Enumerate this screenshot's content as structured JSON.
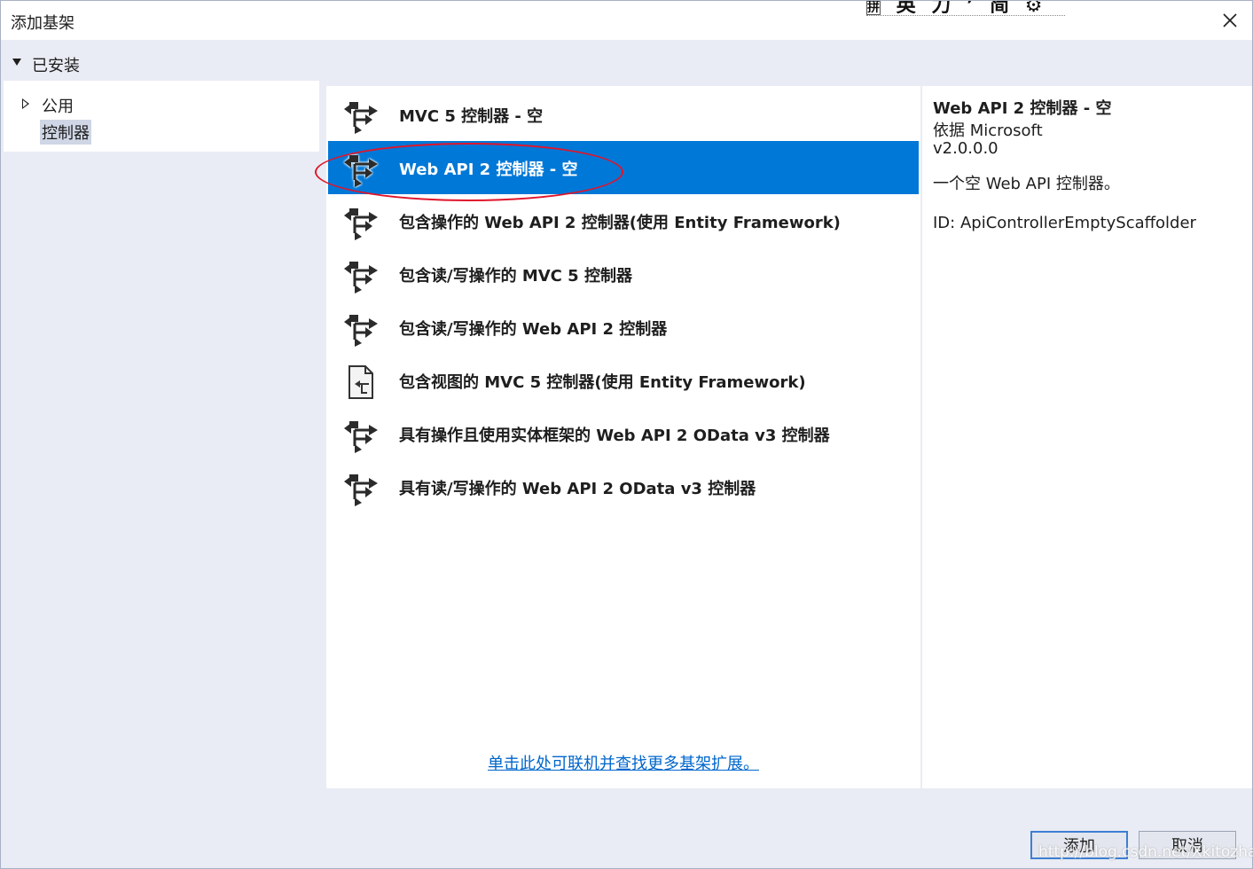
{
  "window": {
    "title": "添加基架"
  },
  "ime_bar": {
    "items": [
      "拼",
      "英",
      "力",
      "’",
      "简",
      "⚙"
    ]
  },
  "tree": {
    "installed_label": "已安装",
    "items": [
      {
        "label": "公用"
      },
      {
        "label": "控制器"
      }
    ]
  },
  "templates": [
    {
      "label": "MVC 5 控制器 - 空",
      "icon": "controller-icon"
    },
    {
      "label": "Web API 2 控制器 - 空",
      "icon": "controller-icon"
    },
    {
      "label": "包含操作的 Web API 2 控制器(使用 Entity Framework)",
      "icon": "controller-icon"
    },
    {
      "label": "包含读/写操作的 MVC 5 控制器",
      "icon": "controller-icon"
    },
    {
      "label": "包含读/写操作的 Web API 2 控制器",
      "icon": "controller-icon"
    },
    {
      "label": "包含视图的 MVC 5 控制器(使用 Entity Framework)",
      "icon": "view-controller-icon"
    },
    {
      "label": "具有操作且使用实体框架的 Web API 2 OData v3 控制器",
      "icon": "controller-icon"
    },
    {
      "label": "具有读/写操作的 Web API 2 OData v3 控制器",
      "icon": "controller-icon"
    }
  ],
  "online_link": "单击此处可联机并查找更多基架扩展。",
  "details": {
    "title": "Web API 2 控制器 - 空",
    "author": "依据 Microsoft",
    "version": "v2.0.0.0",
    "description": "一个空 Web API 控制器。",
    "id": "ID: ApiControllerEmptyScaffolder"
  },
  "buttons": {
    "add": "添加",
    "cancel": "取消"
  },
  "watermark": "http://blog.csdn.net/Xkitozhang",
  "colors": {
    "accent": "#0078d7",
    "link": "#0066cc",
    "annotation": "#e0152b"
  }
}
